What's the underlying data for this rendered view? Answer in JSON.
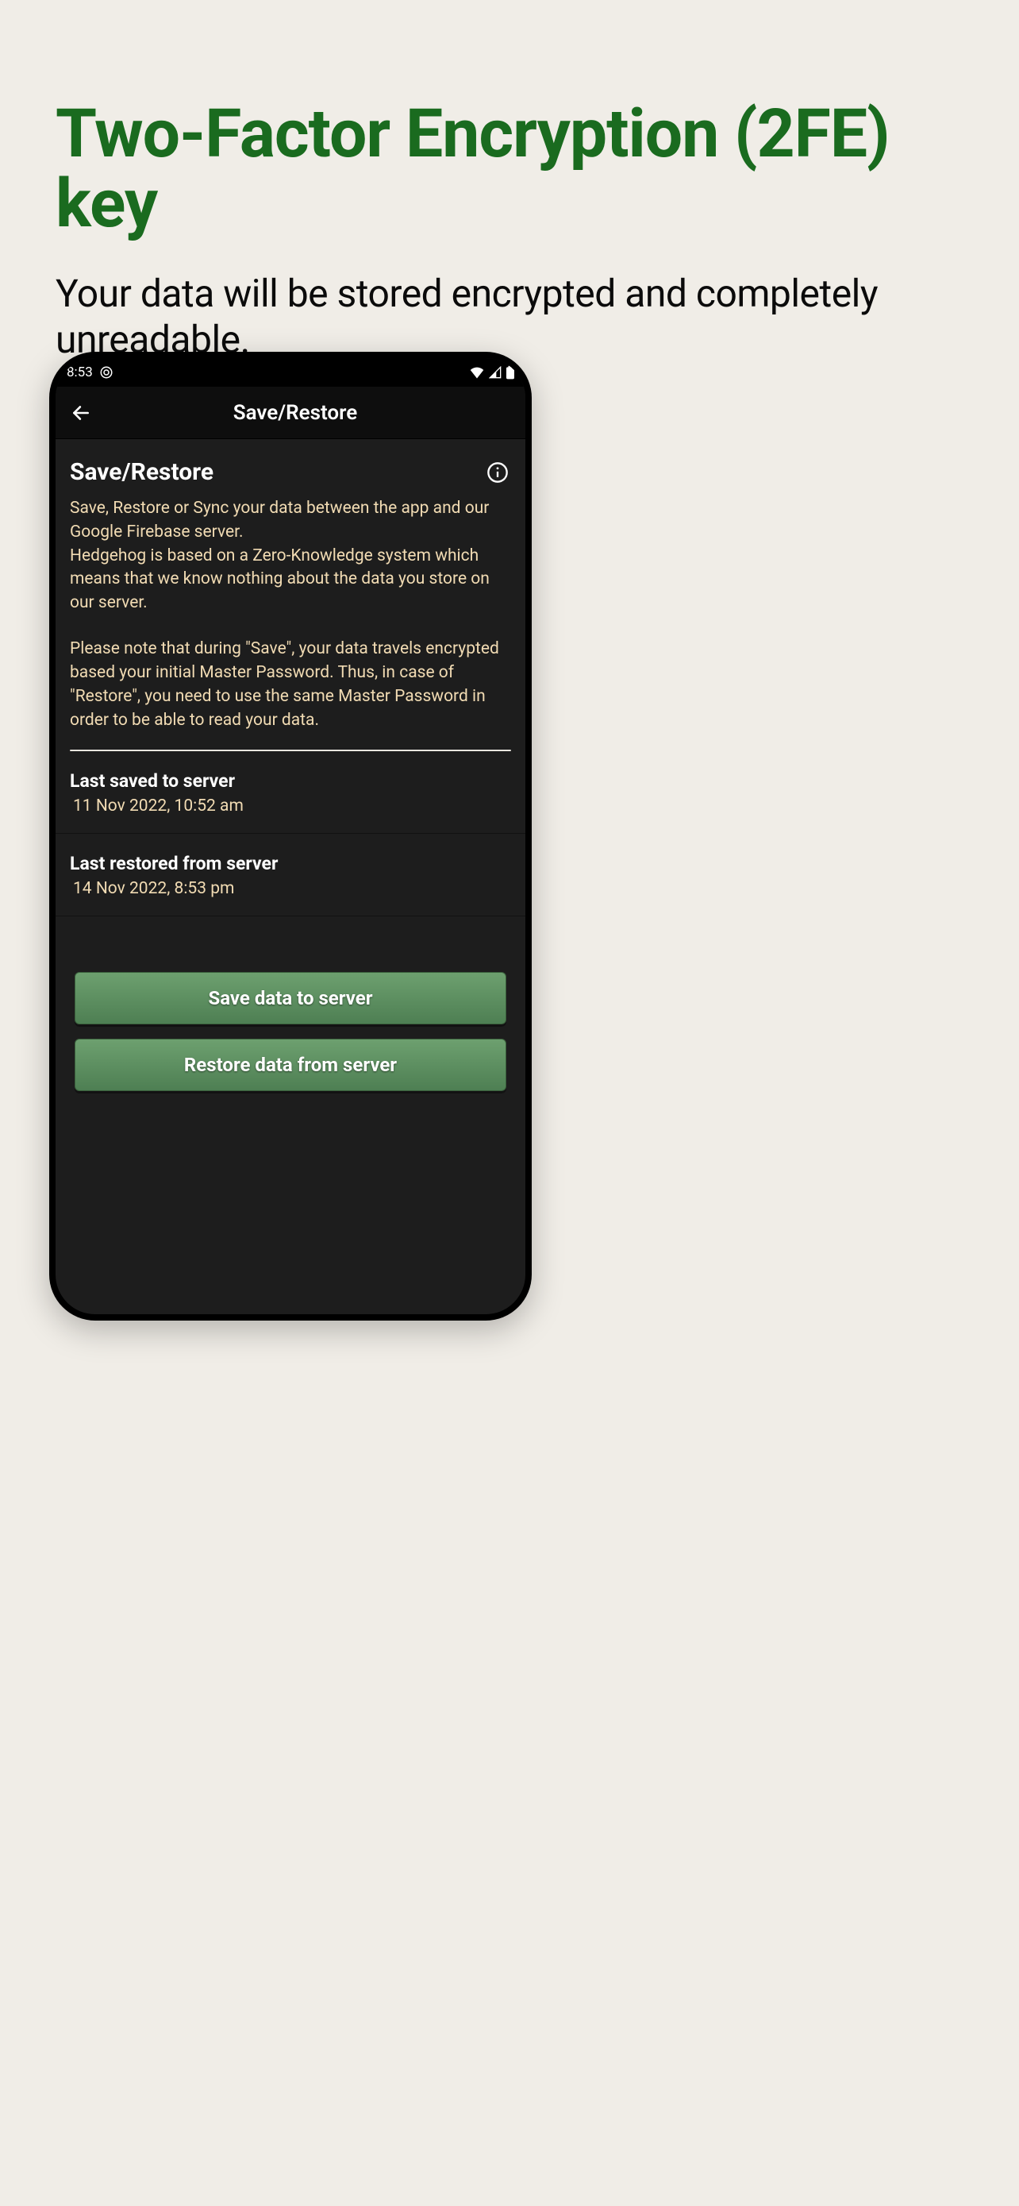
{
  "promo": {
    "title": "Two-Factor Encryption (2FE) key",
    "subtitle": "Your data will be stored encrypted and completely unreadable."
  },
  "statusbar": {
    "time": "8:53"
  },
  "appbar": {
    "title": "Save/Restore"
  },
  "section": {
    "title": "Save/Restore",
    "para1": "Save, Restore or Sync your data between the app and our Google Firebase server.\nHedgehog is based on a Zero-Knowledge system which means that we know nothing about the data you store on our server.",
    "para2": "Please note that during \"Save\", your data travels encrypted based your initial Master Password. Thus, in case of \"Restore\", you need to use the same Master Password in order to be able to read your data."
  },
  "rows": {
    "savedLabel": "Last saved to server",
    "savedValue": "11 Nov 2022, 10:52 am",
    "restoredLabel": "Last restored from server",
    "restoredValue": "14 Nov 2022, 8:53 pm"
  },
  "buttons": {
    "save": "Save data to server",
    "restore": "Restore data from server"
  }
}
